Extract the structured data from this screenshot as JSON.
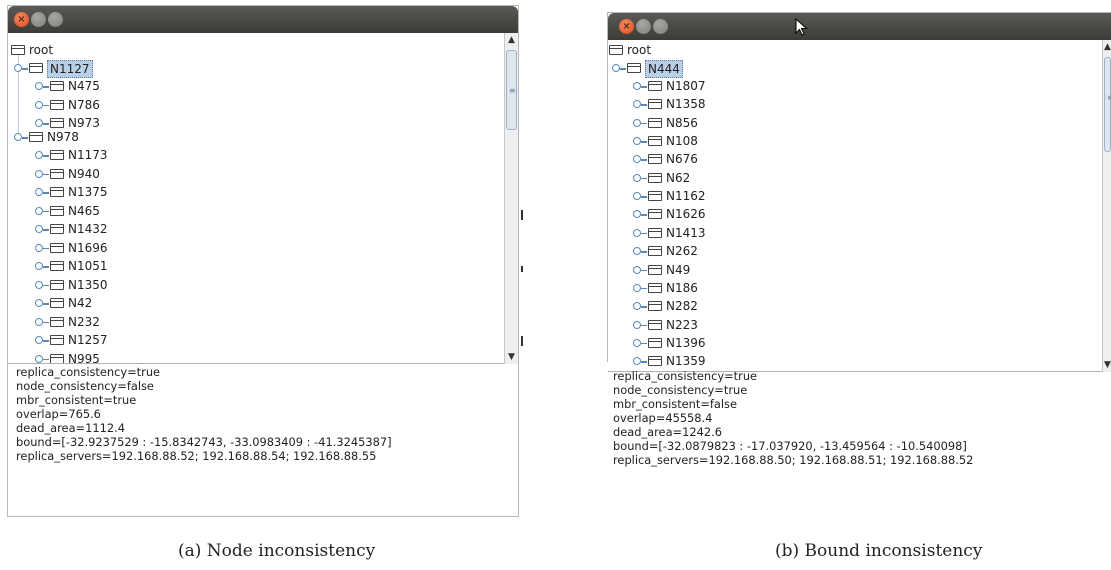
{
  "panel_a": {
    "tree": {
      "root": "root",
      "selected": "N1127",
      "selected_children": [
        "N475",
        "N786",
        "N973"
      ],
      "sibling": "N978",
      "sibling_children": [
        "N1173",
        "N940",
        "N1375",
        "N465",
        "N1432",
        "N1696",
        "N1051",
        "N1350",
        "N42",
        "N232",
        "N1257",
        "N995"
      ]
    },
    "info": {
      "replica_consistency": "replica_consistency=true",
      "node_consistency": "node_consistency=false",
      "mbr_consistent": "mbr_consistent=true",
      "overlap": "overlap=765.6",
      "dead_area": "dead_area=1112.4",
      "bound": "bound=[-32.9237529 : -15.8342743, -33.0983409 : -41.3245387]",
      "replica_servers": "replica_servers=192.168.88.52; 192.168.88.54; 192.168.88.55"
    },
    "caption": "(a) Node inconsistency"
  },
  "panel_b": {
    "tree": {
      "root": "root",
      "selected": "N444",
      "selected_children": [
        "N1807",
        "N1358",
        "N856",
        "N108",
        "N676",
        "N62",
        "N1162",
        "N1626",
        "N1413",
        "N262",
        "N49",
        "N186",
        "N282",
        "N223",
        "N1396",
        "N1359"
      ]
    },
    "info": {
      "replica_consistency": "replica_consistency=true",
      "node_consistency": "node_consistency=true",
      "mbr_consistent": "mbr_consistent=false",
      "overlap": "overlap=45558.4",
      "dead_area": "dead_area=1242.6",
      "bound": "bound=[-32.0879823 : -17.037920, -13.459564 : -10.540098]",
      "replica_servers": "replica_servers=192.168.88.50; 192.168.88.51; 192.168.88.52"
    },
    "caption": "(b) Bound inconsistency"
  },
  "icons": {
    "close": "×",
    "scroll_up": "▲",
    "scroll_down": "▼"
  },
  "colors": {
    "titlebar": "#3c3b37",
    "close_button": "#df4a16",
    "selection": "#b8cfe5",
    "tree_handle": "#5a88b8"
  }
}
